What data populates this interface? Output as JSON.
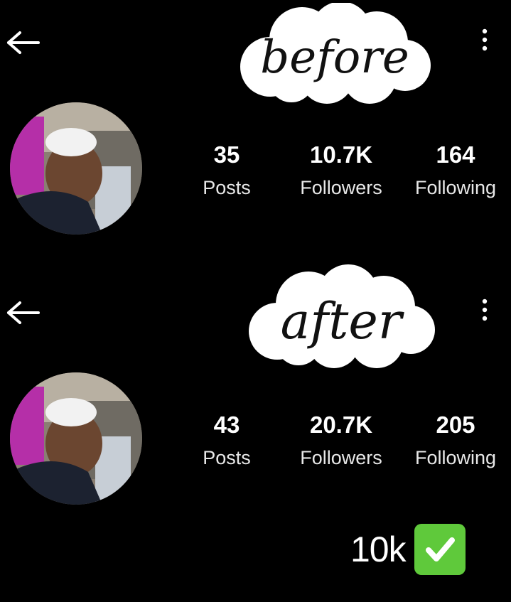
{
  "before": {
    "label": "before",
    "stats": {
      "posts_value": "35",
      "posts_label": "Posts",
      "followers_value": "10.7K",
      "followers_label": "Followers",
      "following_value": "164",
      "following_label": "Following"
    }
  },
  "after": {
    "label": "after",
    "stats": {
      "posts_value": "43",
      "posts_label": "Posts",
      "followers_value": "20.7K",
      "followers_label": "Followers",
      "following_value": "205",
      "following_label": "Following"
    }
  },
  "badge": {
    "text": "10k",
    "icon": "check-mark-button-icon"
  },
  "icons": {
    "back": "back-arrow-icon",
    "more": "more-vertical-icon"
  },
  "colors": {
    "background": "#000000",
    "text": "#ffffff",
    "check_green": "#5fc93b"
  }
}
